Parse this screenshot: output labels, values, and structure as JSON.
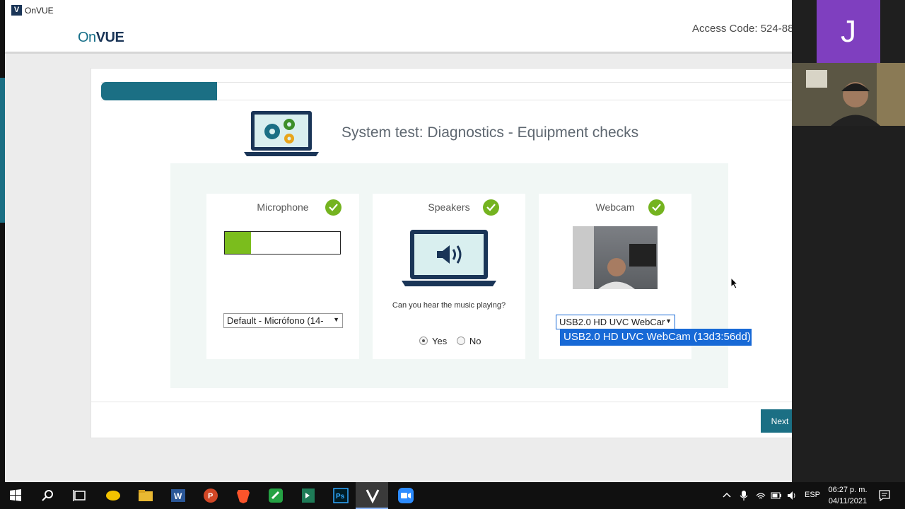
{
  "window": {
    "title": "OnVUE"
  },
  "header": {
    "logo_on": "On",
    "logo_v": "V",
    "logo_ue": "UE",
    "access_code": "Access Code: 524-88"
  },
  "progress": {
    "fraction": 0.166
  },
  "page_title": "System test: Diagnostics - Equipment checks",
  "microphone": {
    "label": "Microphone",
    "level_fraction": 0.23,
    "device_value": "Default - Micrófono (14-"
  },
  "speakers": {
    "label": "Speakers",
    "question": "Can you hear the music playing?",
    "yes_label": "Yes",
    "no_label": "No",
    "selected": "Yes"
  },
  "webcam": {
    "label": "Webcam",
    "device_value": "USB2.0 HD UVC WebCar",
    "dropdown_option": "USB2.0 HD UVC WebCam (13d3:56dd)"
  },
  "actions": {
    "next_label": "Next"
  },
  "zoom": {
    "participant_initial": "J"
  },
  "taskbar": {
    "language": "ESP",
    "time": "06:27 p. m.",
    "date": "04/11/2021"
  },
  "colors": {
    "teal": "#1b6f84",
    "green": "#74b31f",
    "selection": "#1769d6",
    "avatar": "#7f3fbf"
  }
}
